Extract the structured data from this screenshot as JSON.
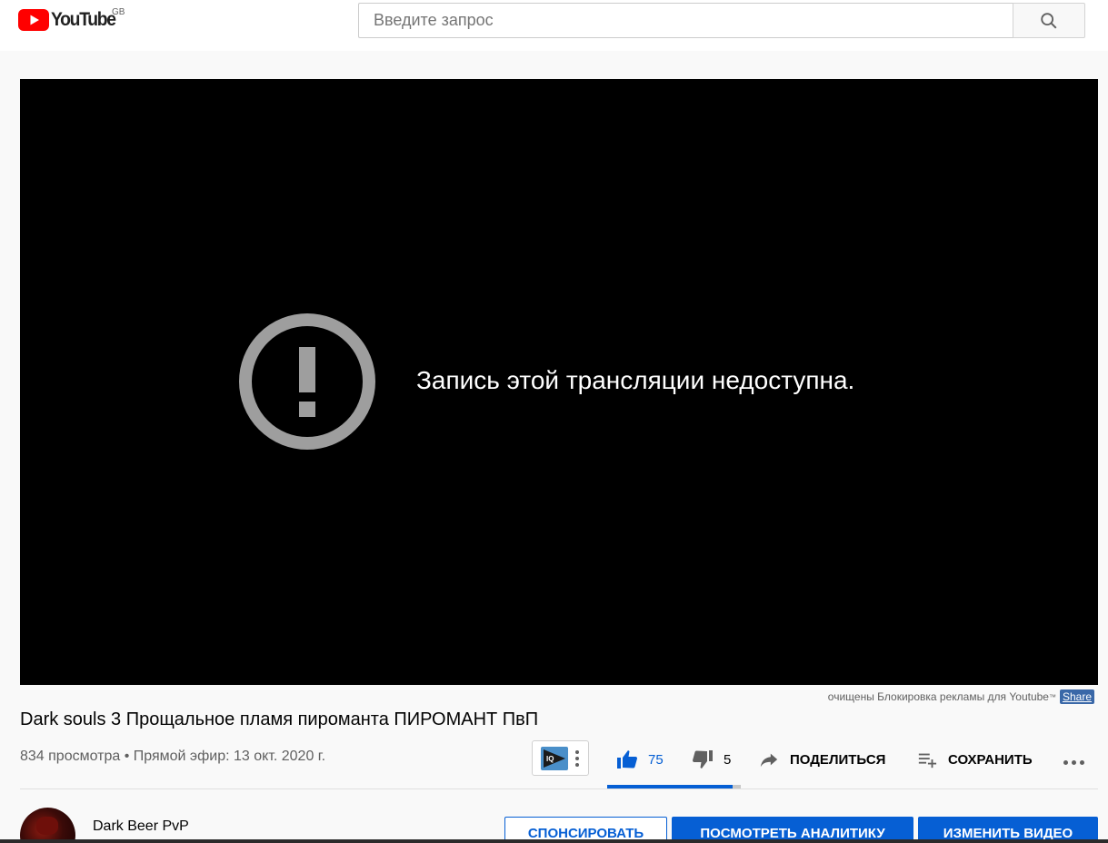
{
  "header": {
    "logo_text": "YouTube",
    "region": "GB",
    "search_placeholder": "Введите запрос",
    "brand_color": "#ff0000"
  },
  "player": {
    "error_message": "Запись этой трансляции недоступна.",
    "icon": "alert-circle-icon"
  },
  "adblock": {
    "text": "очищены Блокировка рекламы для Youtube",
    "tm": "™",
    "share_label": "Share"
  },
  "video": {
    "title": "Dark souls 3 Прощальное пламя пироманта ПИРОМАНТ ПвП",
    "meta": "834 просмотра • Прямой эфир: 13 окт. 2020 г."
  },
  "actions": {
    "likes": "75",
    "dislikes": "5",
    "share_label": "ПОДЕЛИТЬСЯ",
    "save_label": "СОХРАНИТЬ",
    "like_ratio": 0.94,
    "accent_color": "#065fd4"
  },
  "channel": {
    "name": "Dark Beer PvP"
  },
  "buttons": {
    "sponsor": "СПОНСИРОВАТЬ",
    "analytics": "ПОСМОТРЕТЬ АНАЛИТИКУ",
    "edit": "ИЗМЕНИТЬ ВИДЕО"
  }
}
